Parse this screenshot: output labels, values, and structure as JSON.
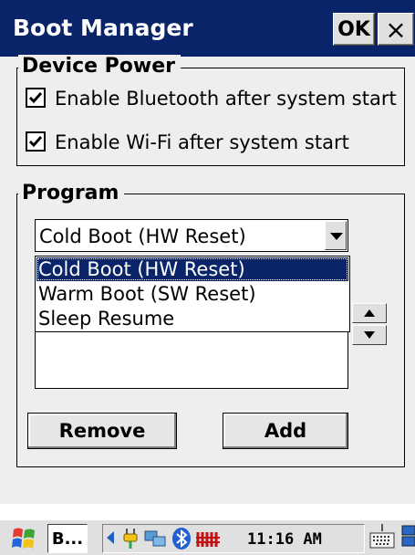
{
  "window": {
    "title": "Boot Manager",
    "ok_label": "OK",
    "close_glyph": "×"
  },
  "device_power": {
    "legend": "Device Power",
    "options": [
      {
        "label": "Enable Bluetooth after system start",
        "checked": true
      },
      {
        "label": "Enable Wi-Fi after system start",
        "checked": true
      }
    ]
  },
  "program": {
    "legend": "Program",
    "combo_value": "Cold Boot (HW Reset)",
    "dropdown_options": [
      "Cold Boot (HW Reset)",
      "Warm Boot (SW Reset)",
      "Sleep Resume"
    ],
    "selected_index": 0,
    "remove_label": "Remove",
    "add_label": "Add"
  },
  "taskbar": {
    "app_label": "B...",
    "clock": "11:16 AM"
  },
  "colors": {
    "title_bar": "#0a246a",
    "selection": "#0a246a",
    "face": "#eeeeee"
  }
}
